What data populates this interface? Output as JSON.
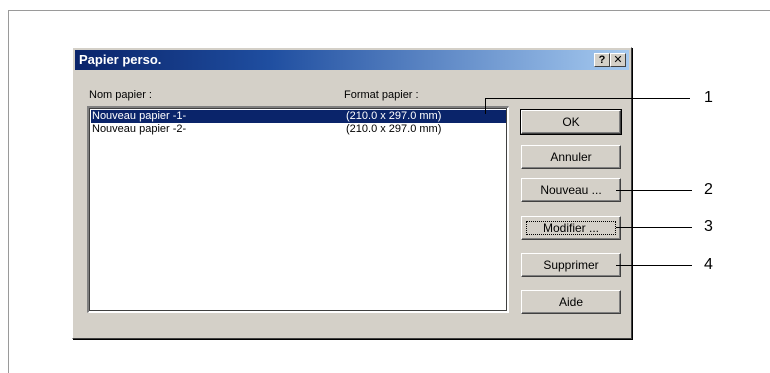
{
  "dialog": {
    "title": "Papier perso.",
    "help_button_label": "?",
    "close_button_label": "✕"
  },
  "list": {
    "columns": [
      "Nom papier :",
      "Format papier :"
    ],
    "rows": [
      {
        "name": "Nouveau papier -1-",
        "format": "(210.0 x 297.0 mm)",
        "selected": true
      },
      {
        "name": "Nouveau papier -2-",
        "format": "(210.0 x 297.0 mm)",
        "selected": false
      }
    ]
  },
  "buttons": {
    "ok": "OK",
    "cancel": "Annuler",
    "new": "Nouveau ...",
    "modify": "Modifier ...",
    "delete": "Supprimer",
    "help": "Aide"
  },
  "callouts": [
    "1",
    "2",
    "3",
    "4"
  ],
  "colors": {
    "selection": "#0a246a",
    "titlebar_start": "#0a246a",
    "titlebar_end": "#a6caf0",
    "dialog_face": "#d4d0c8"
  }
}
